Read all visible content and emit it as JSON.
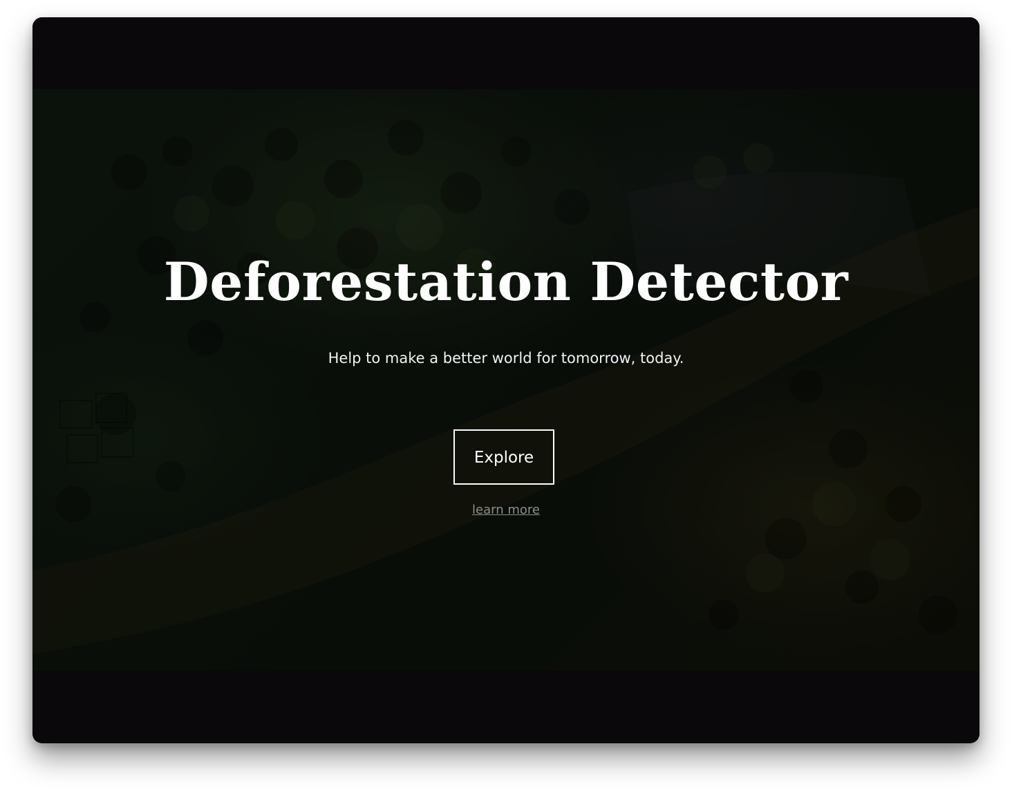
{
  "hero": {
    "title": "Deforestation Detector",
    "subtitle": "Help to make a better world for tomorrow, today.",
    "explore_label": "Explore",
    "learn_more_label": "learn more"
  },
  "colors": {
    "frame_background": "#0b080b",
    "text_primary": "#ffffff",
    "link_muted": "#8d8d8d"
  }
}
